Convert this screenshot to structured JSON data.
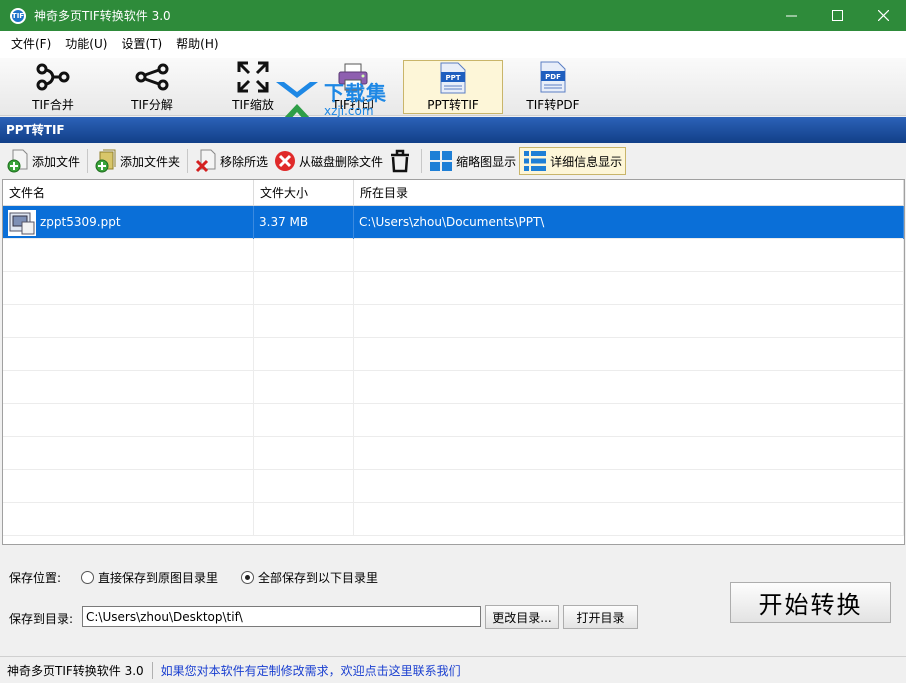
{
  "window": {
    "title": "神奇多页TIF转换软件 3.0",
    "icon_label": "TIF"
  },
  "menu": [
    "文件(F)",
    "功能(U)",
    "设置(T)",
    "帮助(H)"
  ],
  "toolbar": [
    {
      "label": "TIF合并",
      "icon": "merge-icon"
    },
    {
      "label": "TIF分解",
      "icon": "split-icon"
    },
    {
      "label": "TIF缩放",
      "icon": "resize-icon"
    },
    {
      "label": "TIF打印",
      "icon": "printer-icon"
    },
    {
      "label": "PPT转TIF",
      "icon": "ppt-file-icon",
      "active": true,
      "badge": "PPT"
    },
    {
      "label": "TIF转PDF",
      "icon": "pdf-file-icon",
      "badge": "PDF"
    }
  ],
  "watermark": {
    "cn": "下载集",
    "en": "xzji.com"
  },
  "section_title": "PPT转TIF",
  "actions": [
    {
      "label": "添加文件",
      "icon": "add-file-icon"
    },
    {
      "label": "添加文件夹",
      "icon": "add-folder-icon"
    },
    {
      "label": "移除所选",
      "icon": "remove-selected-icon"
    },
    {
      "label": "从磁盘删除文件",
      "icon": "delete-from-disk-icon"
    },
    {
      "label": "",
      "icon": "trash-icon"
    },
    {
      "label": "缩略图显示",
      "icon": "thumbnail-view-icon"
    },
    {
      "label": "详细信息显示",
      "icon": "detail-view-icon",
      "active": true
    }
  ],
  "table": {
    "headers": [
      "文件名",
      "文件大小",
      "所在目录"
    ],
    "rows": [
      {
        "name": "zppt5309.ppt",
        "size": "3.37 MB",
        "dir": "C:\\Users\\zhou\\Documents\\PPT\\",
        "selected": true
      }
    ]
  },
  "save": {
    "position_label": "保存位置:",
    "option1": "直接保存到原图目录里",
    "option2": "全部保存到以下目录里",
    "selected_option": 2,
    "dir_label": "保存到目录:",
    "dir_value": "C:\\Users\\zhou\\Desktop\\tif\\",
    "change_btn": "更改目录...",
    "open_btn": "打开目录",
    "start_btn": "开始转换"
  },
  "status": {
    "app": "神奇多页TIF转换软件 3.0",
    "link": "如果您对本软件有定制修改需求，欢迎点击这里联系我们"
  },
  "colors": {
    "titlebar": "#2e8b3a",
    "section": "#1a4c9c",
    "selection": "#0a6fd8",
    "link": "#1a3fd0"
  }
}
